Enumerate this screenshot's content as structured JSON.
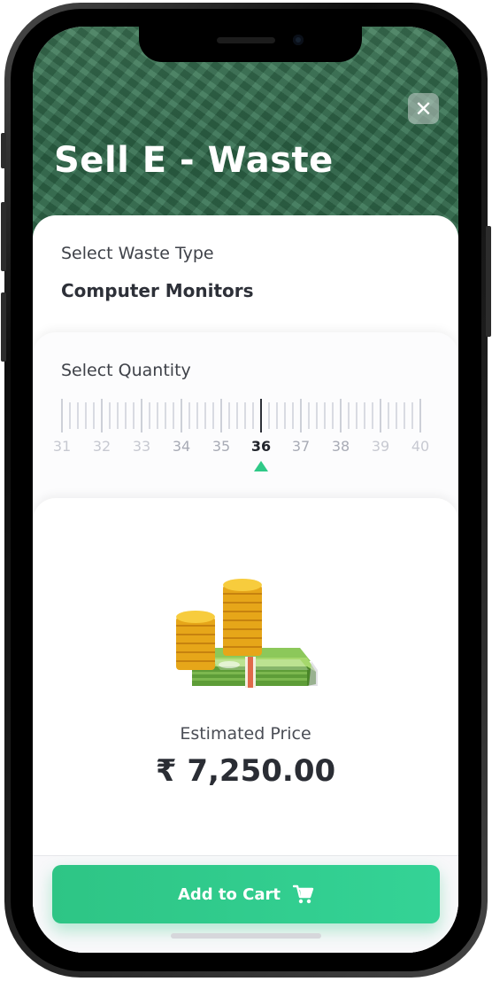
{
  "header": {
    "title": "Sell E - Waste",
    "close_icon": "close-icon"
  },
  "waste_type": {
    "label": "Select Waste Type",
    "value": "Computer Monitors"
  },
  "quantity": {
    "label": "Select Quantity",
    "scale": [
      "31",
      "32",
      "33",
      "34",
      "35",
      "36",
      "37",
      "38",
      "39",
      "40"
    ],
    "selected": "36"
  },
  "estimate": {
    "label": "Estimated Price",
    "price": "₹ 7,250.00",
    "illustration": "coins-and-cash-icon"
  },
  "actions": {
    "add_to_cart": "Add to Cart",
    "cart_icon": "cart-icon"
  },
  "colors": {
    "accent": "#2ec585",
    "header_bg": "#3a7755"
  }
}
